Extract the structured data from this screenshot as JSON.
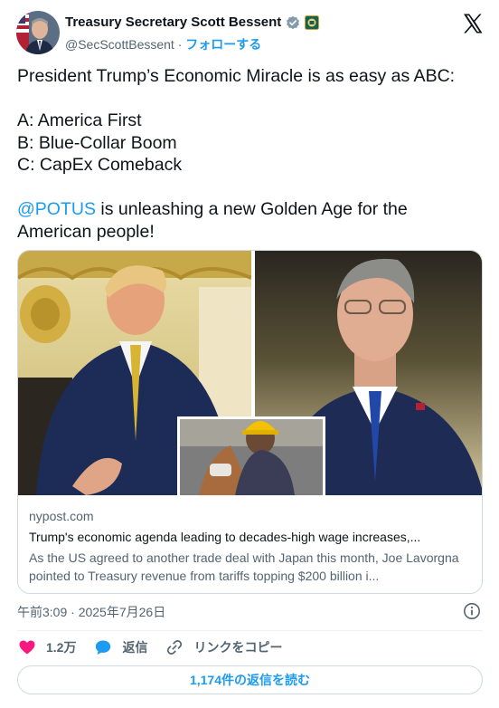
{
  "author": {
    "display_name": "Treasury Secretary Scott Bessent",
    "handle": "@SecScottBessent",
    "separator": " · ",
    "follow_label": "フォローする",
    "verified_icon": "verified-badge-icon",
    "affiliation_icon": "treasury-seal-icon"
  },
  "platform_icon": "x-logo-icon",
  "tweet": {
    "line1": "President Trump’s Economic Miracle is as easy as ABC:",
    "line_a": "A: America First",
    "line_b": "B: Blue-Collar Boom",
    "line_c": "C: CapEx Comeback",
    "mention": "@POTUS",
    "line_tail_1": " is unleashing a new Golden Age for the",
    "line_tail_2": "American people!"
  },
  "link_card": {
    "domain": "nypost.com",
    "title": "Trump's economic agenda leading to decades-high wage increases,...",
    "description": "As the US agreed to another trade deal with Japan this month, Joe Lavorgna pointed to Treasury revenue from tariffs topping $200 billion i..."
  },
  "timestamp": "午前3:09 · 2025年7月26日",
  "actions": {
    "likes": "1.2万",
    "reply_label": "返信",
    "share_label": "リンクをコピー"
  },
  "read_replies_label": "1,174件の返信を読む",
  "colors": {
    "accent": "#1d9bf0",
    "like": "#f91880",
    "text": "#0f1419",
    "muted": "#536471",
    "border": "#cfd9de"
  }
}
